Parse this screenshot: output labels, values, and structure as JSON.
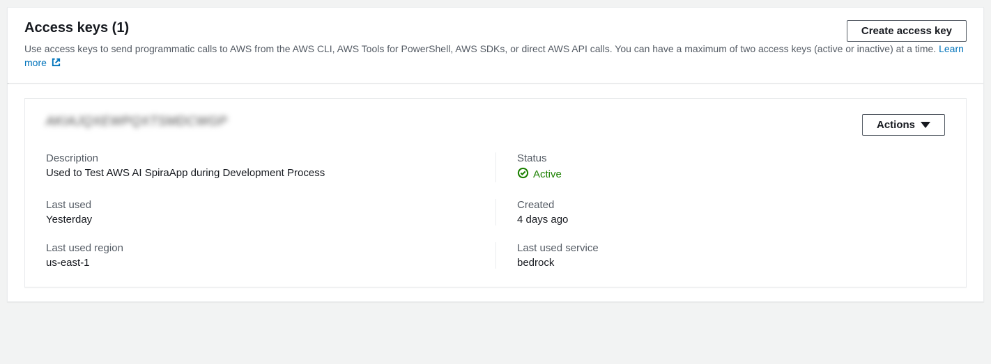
{
  "header": {
    "title": "Access keys (1)",
    "create_btn": "Create access key",
    "description": "Use access keys to send programmatic calls to AWS from the AWS CLI, AWS Tools for PowerShell, AWS SDKs, or direct AWS API calls. You can have a maximum of two access keys (active or inactive) at a time. ",
    "learn_more": "Learn more"
  },
  "key": {
    "id_masked": "AKIAJQXEWPQXTSMDCWGP",
    "actions_btn": "Actions",
    "fields": {
      "description": {
        "label": "Description",
        "value": "Used to Test AWS AI SpiraApp during Development Process"
      },
      "status": {
        "label": "Status",
        "value": "Active"
      },
      "last_used": {
        "label": "Last used",
        "value": "Yesterday"
      },
      "created": {
        "label": "Created",
        "value": "4 days ago"
      },
      "last_used_region": {
        "label": "Last used region",
        "value": "us-east-1"
      },
      "last_used_service": {
        "label": "Last used service",
        "value": "bedrock"
      }
    }
  }
}
